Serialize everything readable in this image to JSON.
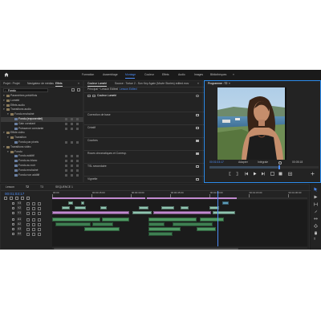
{
  "top_bar": {
    "home_icon": "home-icon",
    "workspaces": [
      "Formation",
      "Assemblage",
      "Montage",
      "Couleur",
      "Effets",
      "Audio",
      "Images",
      "Bibliothèques"
    ],
    "active_workspace": "Montage",
    "overflow": "»"
  },
  "left_panel": {
    "tabs": [
      "Projet : Projet",
      "Navigateur de médias",
      "Effets"
    ],
    "active_tab": "Effets",
    "search_value": "Fondu",
    "tree": [
      {
        "label": "Paramètres prédéfinis",
        "level": 0
      },
      {
        "label": "Lumetri",
        "level": 0
      },
      {
        "label": "Effets audio",
        "level": 0
      },
      {
        "label": "Transitions audio",
        "level": 0
      },
      {
        "label": "Fondu enchaîné",
        "level": 1
      },
      {
        "label": "Fondu (exponentiel)",
        "level": 2
      },
      {
        "label": "Gain constant",
        "level": 2
      },
      {
        "label": "Puissance constante",
        "level": 2
      },
      {
        "label": "Effets vidéo",
        "level": 0
      },
      {
        "label": "Transition",
        "level": 1
      },
      {
        "label": "Fondu par pixels",
        "level": 2
      },
      {
        "label": "Transitions vidéo",
        "level": 0
      },
      {
        "label": "Fondu",
        "level": 1
      },
      {
        "label": "Fondu additif",
        "level": 2
      },
      {
        "label": "Fondu au blanc",
        "level": 2
      },
      {
        "label": "Fondu au noir",
        "level": 2
      },
      {
        "label": "Fondu enchaîné",
        "level": 2
      },
      {
        "label": "Fondu non additif",
        "level": 2
      }
    ],
    "selected_index": 5
  },
  "effect_controls": {
    "tabs": [
      "Couleur Lumetri",
      "Source : Tortue 2 - Sun Key Again (Movie Stories) edited.mov",
      "Lumetri"
    ],
    "active_tab": "Couleur Lumetri",
    "path_main": "Principal * Lesson Edited",
    "path_clip": "Lesson Edited",
    "sections": [
      "Couleur Lumetri",
      "Correction de base",
      "Créatif",
      "Courbes",
      "Roues chromatiques et Corresp.",
      "TSL secondaire",
      "Vignette"
    ]
  },
  "program_monitor": {
    "title": "Programme : T2",
    "timecode": "00:01:03:17",
    "duration": "00:05:18",
    "fit": "Adapter",
    "quality": "Intégrale"
  },
  "timeline": {
    "tabs": [
      "Lesson",
      "T2",
      "T3",
      "SEQUENCE 1"
    ],
    "active_tab": "T2",
    "timecode": "00:01:03:17",
    "ruler_labels": [
      "00:00",
      "00:00:15:00",
      "00:00:30:00",
      "00:00:45:00",
      "00:01:00:00",
      "00:01:15:00",
      "00:01:30:00"
    ],
    "tracks": [
      "V3",
      "V2",
      "V1",
      "A1",
      "A2",
      "A3",
      "A4"
    ]
  },
  "colors": {
    "accent": "#2d8ceb",
    "active_workspace": "#4d8cf5",
    "video_clip": "#8fc4b0",
    "audio_clip": "#4f9a64",
    "pink_clip": "#c28ad0"
  }
}
